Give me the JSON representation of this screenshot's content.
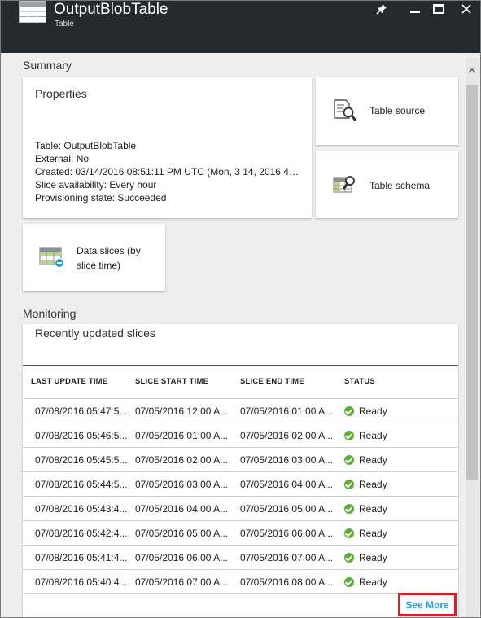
{
  "header": {
    "title": "OutputBlobTable",
    "subtitle": "Table",
    "icon": "table-icon",
    "buttons": [
      "pin-icon",
      "minimize-icon",
      "maximize-icon",
      "close-icon"
    ]
  },
  "summary": {
    "section_title": "Summary",
    "properties": {
      "title": "Properties",
      "lines": [
        "Table: OutputBlobTable",
        "External: No",
        "Created: 03/14/2016 08:51:11 PM UTC (Mon, 3 14, 2016 4:5...",
        "Slice availability: Every hour",
        "Provisioning state: Succeeded"
      ]
    },
    "tiles": {
      "table_source": "Table source",
      "table_schema": "Table schema",
      "data_slices_line1": "Data slices (by",
      "data_slices_line2": "slice time)"
    }
  },
  "monitoring": {
    "section_title": "Monitoring",
    "card_title": "Recently updated slices",
    "columns": [
      "LAST UPDATE TIME",
      "SLICE START TIME",
      "SLICE END TIME",
      "STATUS"
    ],
    "rows": [
      [
        "07/08/2016 05:47:5...",
        "07/05/2016 12:00 A...",
        "07/05/2016 01:00 A...",
        "Ready"
      ],
      [
        "07/08/2016 05:46:5...",
        "07/05/2016 01:00 A...",
        "07/05/2016 02:00 A...",
        "Ready"
      ],
      [
        "07/08/2016 05:45:5...",
        "07/05/2016 02:00 A...",
        "07/05/2016 03:00 A...",
        "Ready"
      ],
      [
        "07/08/2016 05:44:5...",
        "07/05/2016 03:00 A...",
        "07/05/2016 04:00 A...",
        "Ready"
      ],
      [
        "07/08/2016 05:43:4...",
        "07/05/2016 04:00 A...",
        "07/05/2016 05:00 A...",
        "Ready"
      ],
      [
        "07/08/2016 05:42:4...",
        "07/05/2016 05:00 A...",
        "07/05/2016 06:00 A...",
        "Ready"
      ],
      [
        "07/08/2016 05:41:4...",
        "07/05/2016 06:00 A...",
        "07/05/2016 07:00 A...",
        "Ready"
      ],
      [
        "07/08/2016 05:40:4...",
        "07/05/2016 07:00 A...",
        "07/05/2016 08:00 A...",
        "Ready"
      ]
    ],
    "see_more": "See More"
  },
  "colors": {
    "header_bg": "#252a2e",
    "status_ready": "#5ab031",
    "link": "#1a9fd8",
    "highlight_box": "#e01b2a"
  }
}
